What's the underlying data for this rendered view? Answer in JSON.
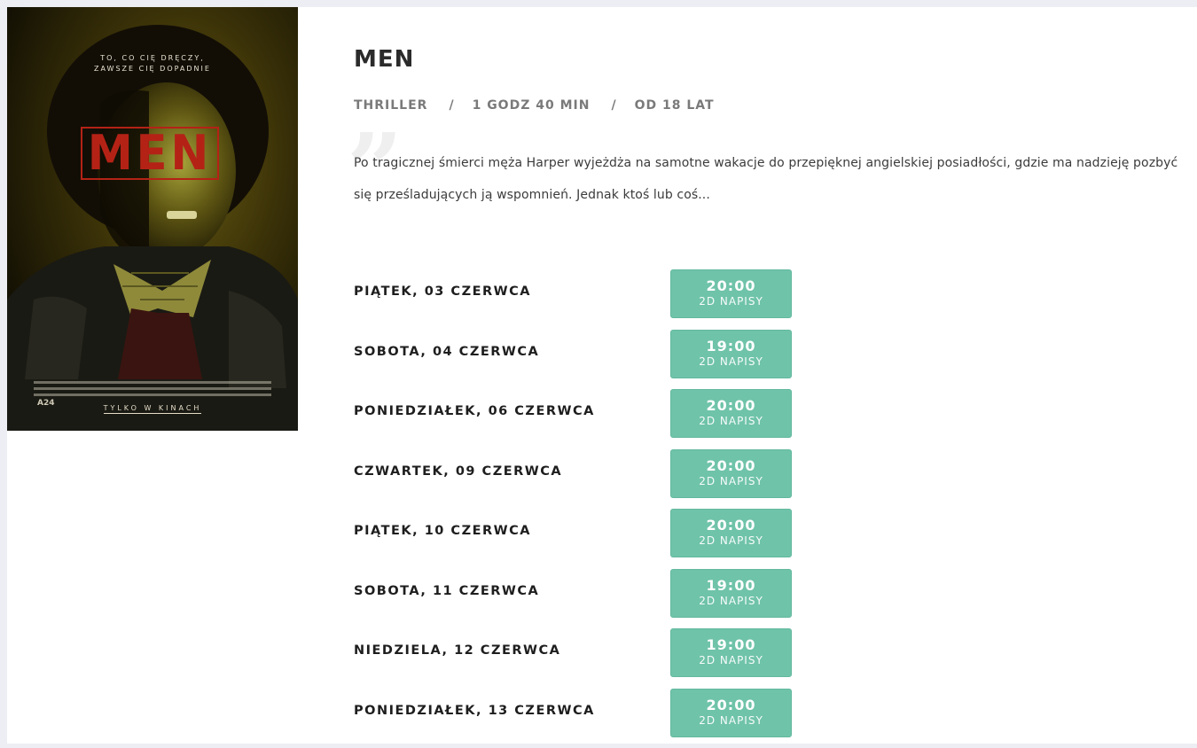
{
  "poster": {
    "tagline_line1": "TO, CO CIĘ DRĘCZY,",
    "tagline_line2": "ZAWSZE CIĘ DOPADNIE",
    "logo_text": "MEN",
    "brand": "A24",
    "footer_text": "TYLKO W KINACH"
  },
  "movie": {
    "title": "MEN",
    "genre": "THRILLER",
    "separator": "/",
    "duration": "1 GODZ 40 MIN",
    "age_rating": "OD 18 LAT",
    "description": "Po tragicznej śmierci męża Harper wyjeżdża na samotne wakacje do przepięknej angielskiej posiadłości, gdzie ma nadzieję pozbyć się prześladujących ją wspomnień. Jednak ktoś lub coś..."
  },
  "schedule": [
    {
      "date": "PIĄTEK, 03 CZERWCA",
      "time": "20:00",
      "format": "2D NAPISY"
    },
    {
      "date": "SOBOTA, 04 CZERWCA",
      "time": "19:00",
      "format": "2D NAPISY"
    },
    {
      "date": "PONIEDZIAŁEK, 06 CZERWCA",
      "time": "20:00",
      "format": "2D NAPISY"
    },
    {
      "date": "CZWARTEK, 09 CZERWCA",
      "time": "20:00",
      "format": "2D NAPISY"
    },
    {
      "date": "PIĄTEK, 10 CZERWCA",
      "time": "20:00",
      "format": "2D NAPISY"
    },
    {
      "date": "SOBOTA, 11 CZERWCA",
      "time": "19:00",
      "format": "2D NAPISY"
    },
    {
      "date": "NIEDZIELA, 12 CZERWCA",
      "time": "19:00",
      "format": "2D NAPISY"
    },
    {
      "date": "PONIEDZIAŁEK, 13 CZERWCA",
      "time": "20:00",
      "format": "2D NAPISY"
    }
  ],
  "colors": {
    "showtime_button": "#6fc3a9",
    "page_background": "#eceef3",
    "logo_red": "#b42216"
  }
}
